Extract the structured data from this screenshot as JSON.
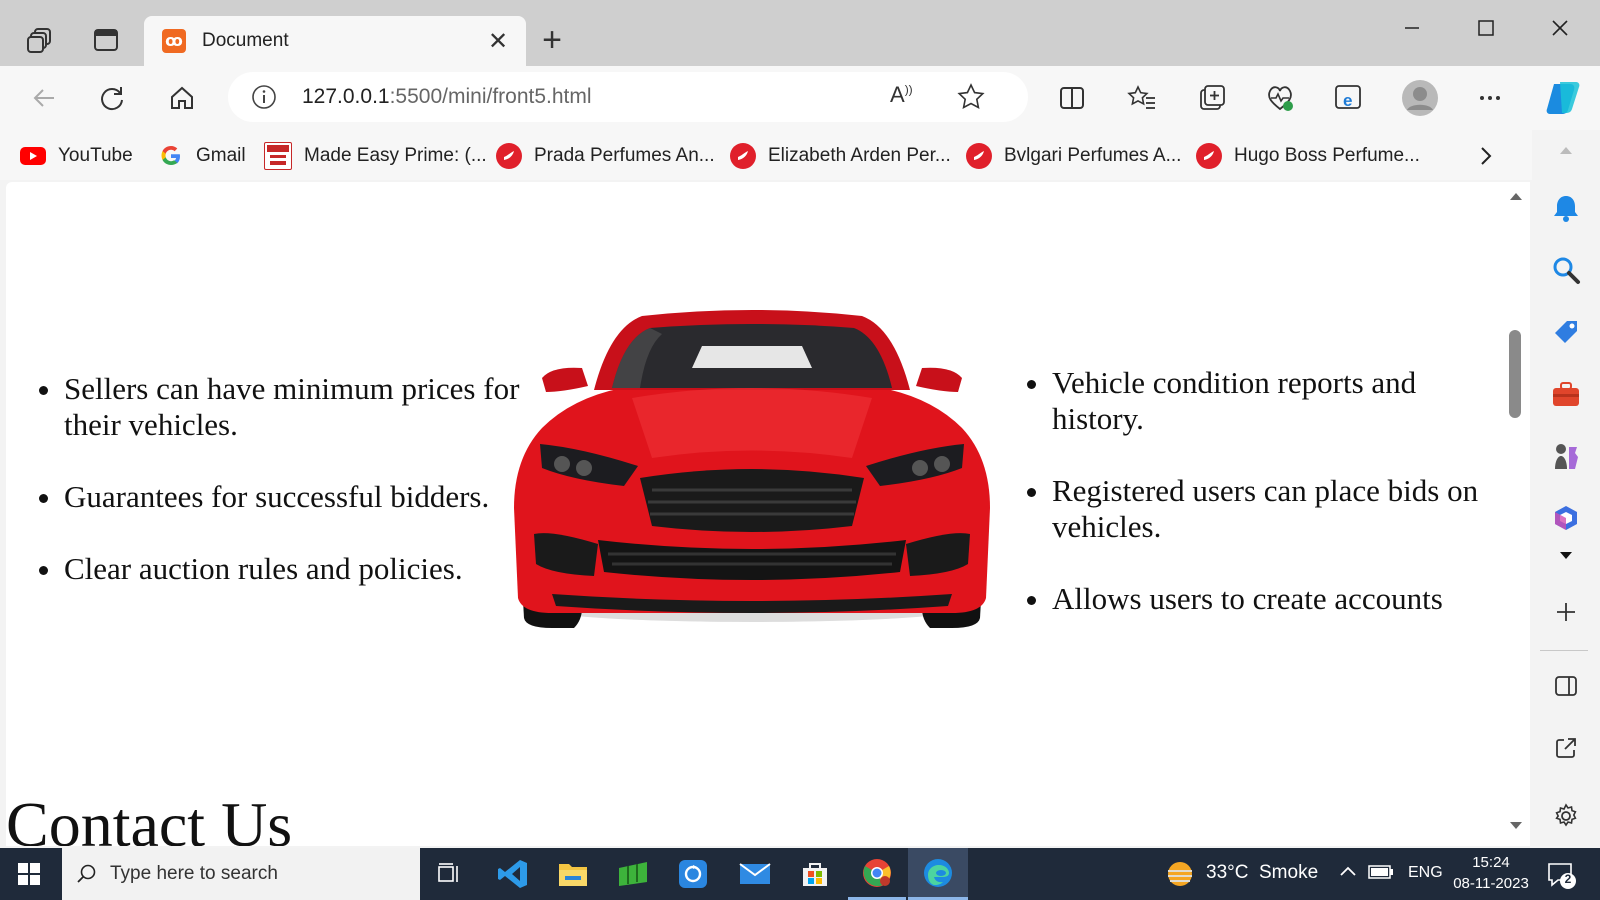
{
  "browser": {
    "tab_title": "Document",
    "address_host": "127.0.0.1",
    "address_path": ":5500/mini/front5.html"
  },
  "bookmarks": [
    {
      "label": "YouTube",
      "icon": "youtube-icon",
      "color": "#ff0000"
    },
    {
      "label": "Gmail",
      "icon": "google-icon",
      "color": "#4285f4"
    },
    {
      "label": "Made Easy Prime: (...",
      "icon": "made-easy-icon",
      "color": "#c62828"
    },
    {
      "label": "Prada Perfumes An...",
      "icon": "perfume-site-icon",
      "color": "#e0202b"
    },
    {
      "label": "Elizabeth Arden Per...",
      "icon": "perfume-site-icon",
      "color": "#e0202b"
    },
    {
      "label": "Bvlgari Perfumes A...",
      "icon": "perfume-site-icon",
      "color": "#e0202b"
    },
    {
      "label": "Hugo Boss Perfume...",
      "icon": "perfume-site-icon",
      "color": "#e0202b"
    }
  ],
  "page": {
    "left_features": [
      "Sellers can have minimum prices for their vehicles.",
      "Guarantees for successful bidders.",
      "Clear auction rules and policies."
    ],
    "right_features": [
      "Vehicle condition reports and history.",
      "Registered users can place bids on vehicles.",
      "Allows users to create accounts"
    ],
    "contact_heading": "Contact Us",
    "car_color": "#e0141c"
  },
  "taskbar": {
    "search_placeholder": "Type here to search",
    "weather": "33°C  Smoke",
    "language": "ENG",
    "time": "15:24",
    "date": "08-11-2023",
    "notification_count": "2"
  }
}
